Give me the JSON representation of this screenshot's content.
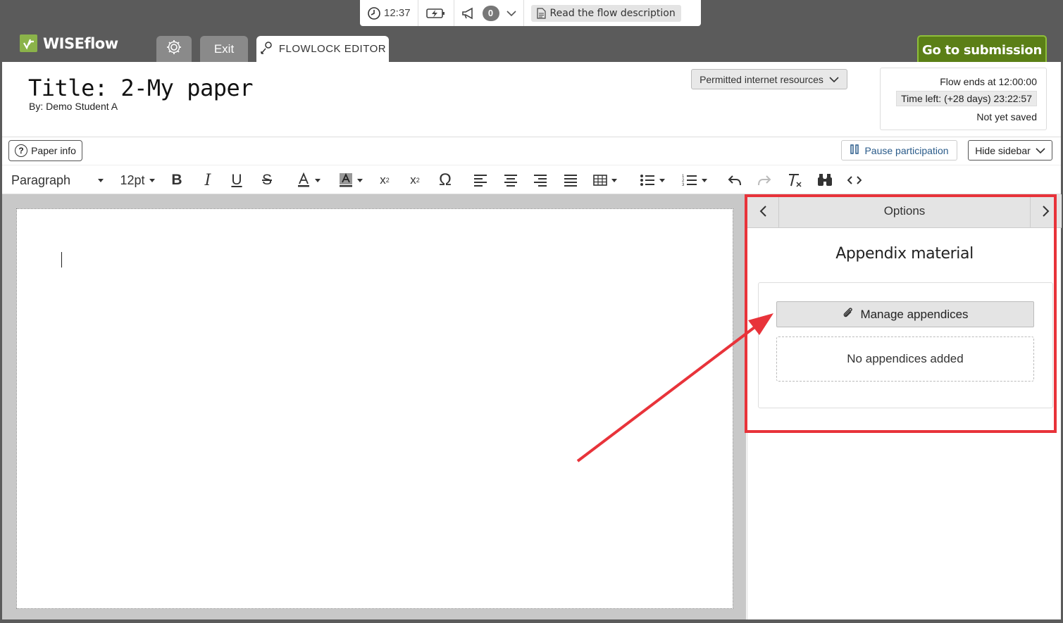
{
  "status_bar": {
    "time": "12:37",
    "notification_count": "0",
    "read_description": "Read the flow description"
  },
  "header": {
    "logo_text": "WISEflow",
    "tabs": {
      "exit": "Exit",
      "editor": "FLOWLOCK EDITOR"
    },
    "go_to_submission": "Go to submission"
  },
  "paper": {
    "title": "Title: 2-My paper",
    "author": "By: Demo Student A"
  },
  "permitted_resources": "Permitted internet resources",
  "flow_info": {
    "ends": "Flow ends at 12:00:00",
    "time_left": "Time left:  (+28 days)  23:22:57",
    "save_status": "Not yet saved"
  },
  "actions": {
    "paper_info": "Paper info",
    "pause": "Pause participation",
    "hide_sidebar": "Hide sidebar"
  },
  "toolbar": {
    "format": "Paragraph",
    "font_size": "12pt"
  },
  "sidebar": {
    "nav_title": "Options",
    "section_title": "Appendix material",
    "manage_label": "Manage appendices",
    "empty_label": "No appendices added"
  },
  "colors": {
    "brand_green": "#5b7f17",
    "annotation_red": "#e8333a",
    "header_bg": "#5b5b5b"
  }
}
